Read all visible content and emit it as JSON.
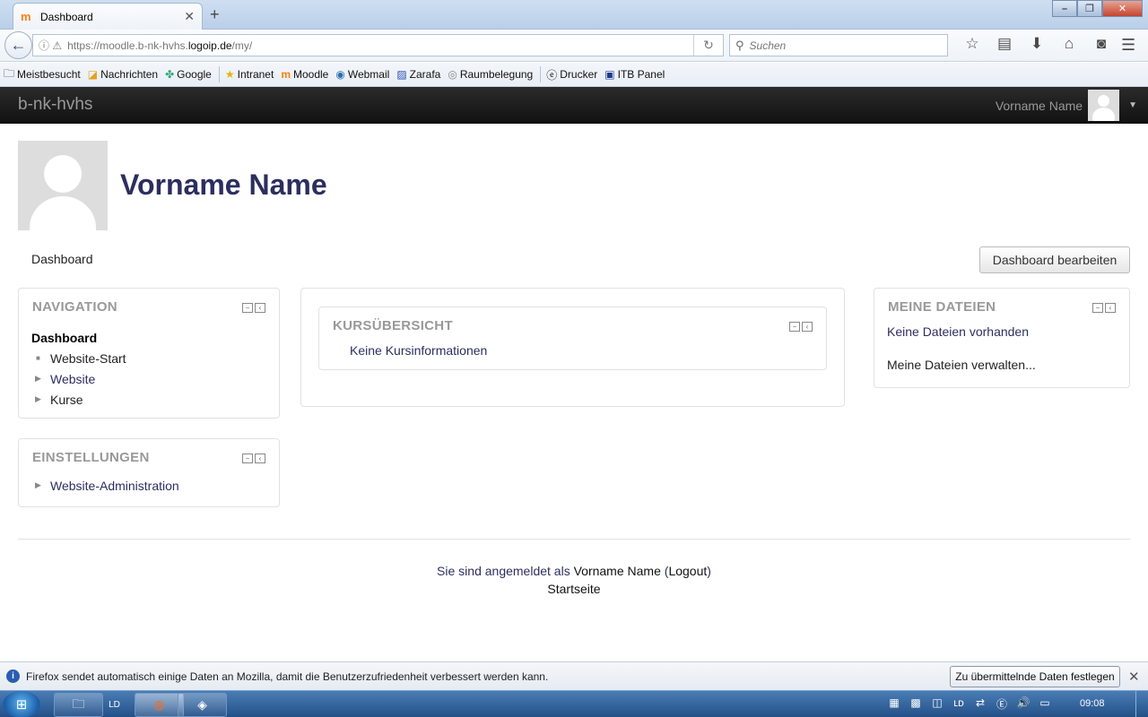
{
  "browser": {
    "tab_title": "Dashboard",
    "tab_icon": "m",
    "new_tab": "+",
    "url_prefix": "https://moodle.b-nk-hvhs.",
    "url_domain": "logoip.de",
    "url_path": "/my/",
    "search_placeholder": "Suchen",
    "bookmarks": [
      "Meistbesucht",
      "Nachrichten",
      "Google",
      "Intranet",
      "Moodle",
      "Webmail",
      "Zarafa",
      "Raumbelegung",
      "Drucker",
      "ITB Panel"
    ]
  },
  "moodle": {
    "brand": "b-nk-hvhs",
    "user_name": "Vorname Name",
    "page_title": "Vorname Name",
    "breadcrumb": "Dashboard",
    "edit_button": "Dashboard bearbeiten",
    "navigation": {
      "title": "NAVIGATION",
      "root": "Dashboard",
      "items": [
        "Website-Start",
        "Website",
        "Kurse"
      ]
    },
    "settings": {
      "title": "EINSTELLUNGEN",
      "items": [
        "Website-Administration"
      ]
    },
    "course_overview": {
      "title": "KURSÜBERSICHT",
      "empty": "Keine Kursinformationen"
    },
    "my_files": {
      "title": "MEINE DATEIEN",
      "empty": "Keine Dateien vorhanden",
      "manage": "Meine Dateien verwalten..."
    },
    "footer": {
      "logged_in_prefix": "Sie sind angemeldet als",
      "user": "Vorname Name",
      "logout": "Logout",
      "home": "Startseite"
    }
  },
  "notification": {
    "text": "Firefox sendet automatisch einige Daten an Mozilla, damit die Benutzerzufriedenheit verbessert werden kann.",
    "button": "Zu übermittelnde Daten festlegen"
  },
  "taskbar": {
    "clock": "09:08"
  }
}
